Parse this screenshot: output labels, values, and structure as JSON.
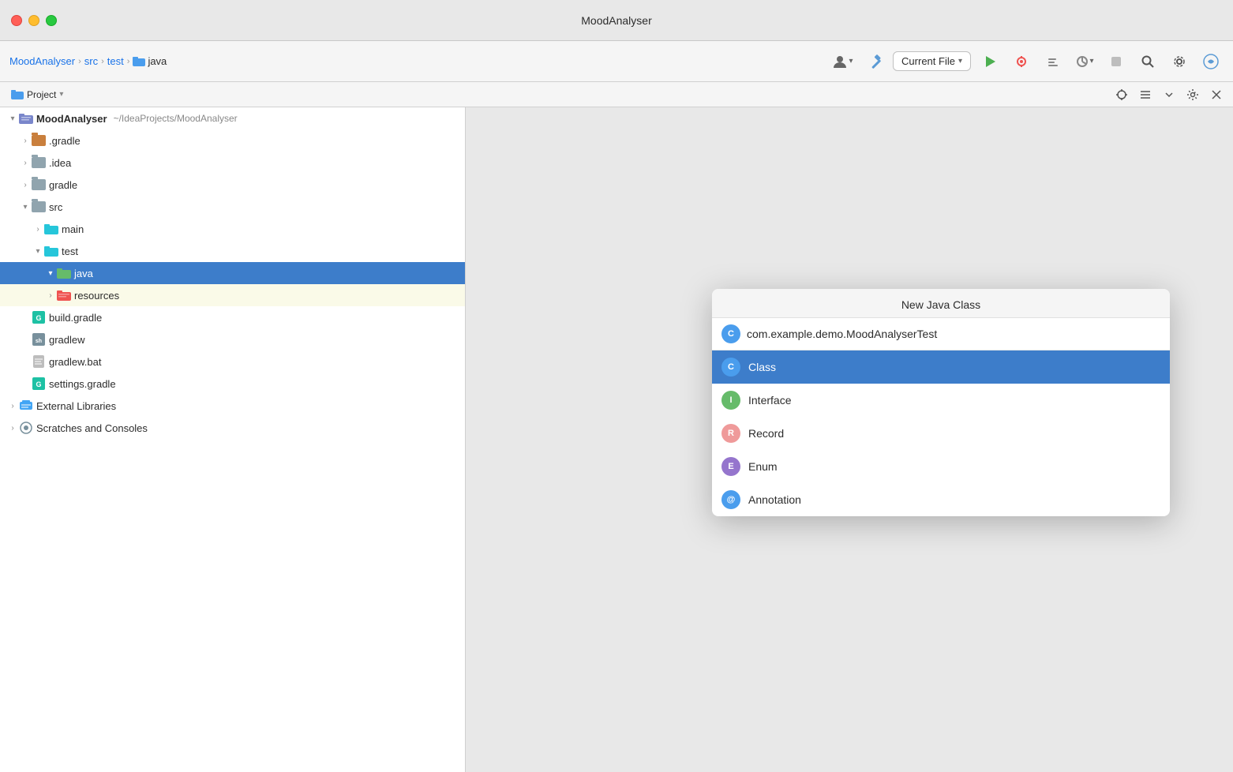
{
  "app": {
    "title": "MoodAnalyser"
  },
  "titlebar": {
    "close": "close",
    "minimize": "minimize",
    "maximize": "maximize"
  },
  "toolbar": {
    "breadcrumb": {
      "root": "MoodAnalyser",
      "src": "src",
      "test": "test",
      "java": "java"
    },
    "current_file_label": "Current File",
    "chevron": "▾"
  },
  "panel": {
    "dropdown_label": "Project",
    "chevron": "▾"
  },
  "tree": {
    "root": {
      "label": "MoodAnalyser",
      "sublabel": "~/IdeaProjects/MoodAnalyser",
      "expanded": true
    },
    "items": [
      {
        "id": "gradle",
        "label": ".gradle",
        "type": "folder-brown",
        "expanded": false,
        "indent": 2
      },
      {
        "id": "idea",
        "label": ".idea",
        "type": "folder-gray",
        "expanded": false,
        "indent": 2
      },
      {
        "id": "gradle2",
        "label": "gradle",
        "type": "folder-gray",
        "expanded": false,
        "indent": 2
      },
      {
        "id": "src",
        "label": "src",
        "type": "folder-plain",
        "expanded": true,
        "indent": 2
      },
      {
        "id": "main",
        "label": "main",
        "type": "folder-cyan",
        "expanded": false,
        "indent": 3
      },
      {
        "id": "test",
        "label": "test",
        "type": "folder-cyan",
        "expanded": true,
        "indent": 3
      },
      {
        "id": "java",
        "label": "java",
        "type": "folder-green",
        "expanded": true,
        "indent": 4,
        "selected": true
      },
      {
        "id": "resources",
        "label": "resources",
        "type": "folder-resource",
        "expanded": false,
        "indent": 4,
        "highlighted": true
      },
      {
        "id": "build-gradle",
        "label": "build.gradle",
        "type": "file-gradle",
        "indent": 2
      },
      {
        "id": "gradlew",
        "label": "gradlew",
        "type": "file-script",
        "indent": 2
      },
      {
        "id": "gradlew-bat",
        "label": "gradlew.bat",
        "type": "file-generic",
        "indent": 2
      },
      {
        "id": "settings-gradle",
        "label": "settings.gradle",
        "type": "file-gradle",
        "indent": 2
      }
    ],
    "external_libs": {
      "label": "External Libraries",
      "expanded": false
    },
    "scratches": {
      "label": "Scratches and Consoles",
      "expanded": false
    }
  },
  "dialog": {
    "title": "New Java Class",
    "input_value": "com.example.demo.MoodAnalyserTest",
    "input_icon": "C",
    "items": [
      {
        "id": "class",
        "label": "Class",
        "icon": "C",
        "icon_type": "icon-class",
        "selected": true
      },
      {
        "id": "interface",
        "label": "Interface",
        "icon": "I",
        "icon_type": "icon-interface",
        "selected": false
      },
      {
        "id": "record",
        "label": "Record",
        "icon": "R",
        "icon_type": "icon-record",
        "selected": false
      },
      {
        "id": "enum",
        "label": "Enum",
        "icon": "E",
        "icon_type": "icon-enum",
        "selected": false
      },
      {
        "id": "annotation",
        "label": "Annotation",
        "icon": "@",
        "icon_type": "icon-annotation",
        "selected": false
      }
    ]
  }
}
